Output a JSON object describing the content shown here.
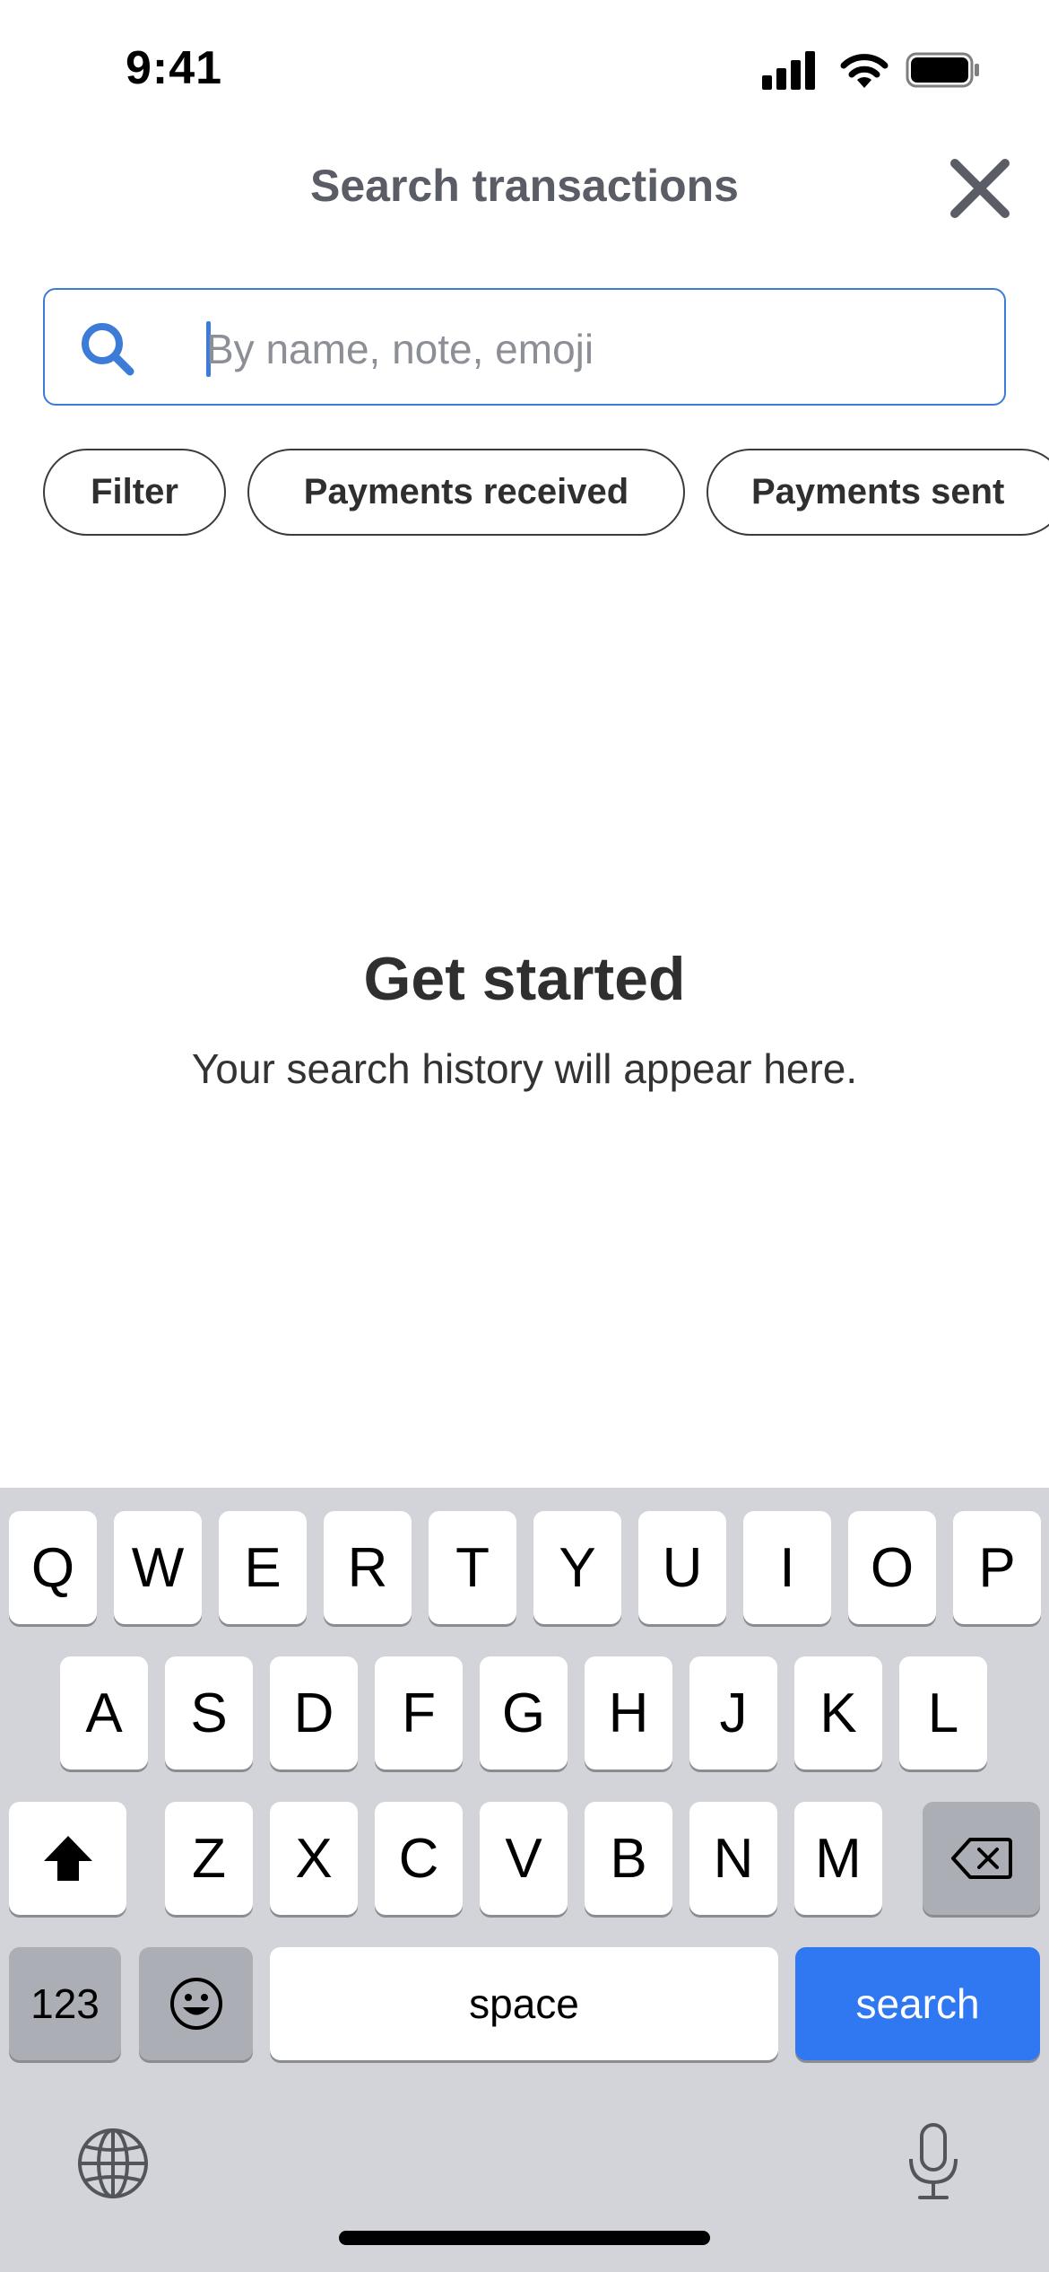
{
  "status_bar": {
    "time": "9:41",
    "icons": [
      "cellular-signal-icon",
      "wifi-icon",
      "battery-icon"
    ]
  },
  "header": {
    "title": "Search transactions",
    "close_icon": "close-icon"
  },
  "search": {
    "placeholder": "By name, note, emoji",
    "value": "",
    "icon": "search-icon"
  },
  "filters": [
    {
      "label": "Filter"
    },
    {
      "label": "Payments received"
    },
    {
      "label": "Payments sent"
    }
  ],
  "empty_state": {
    "title": "Get started",
    "subtitle": "Your search history will appear here."
  },
  "keyboard": {
    "row1": [
      "Q",
      "W",
      "E",
      "R",
      "T",
      "Y",
      "U",
      "I",
      "O",
      "P"
    ],
    "row2": [
      "A",
      "S",
      "D",
      "F",
      "G",
      "H",
      "J",
      "K",
      "L"
    ],
    "row3": [
      "Z",
      "X",
      "C",
      "V",
      "B",
      "N",
      "M"
    ],
    "numbers_label": "123",
    "space_label": "space",
    "action_label": "search",
    "icons": [
      "shift-icon",
      "backspace-icon",
      "emoji-icon",
      "globe-icon",
      "microphone-icon"
    ]
  },
  "colors": {
    "accent": "#3d7bd9",
    "keyboard_action": "#2f78f2",
    "keyboard_background": "#d2d4da"
  }
}
